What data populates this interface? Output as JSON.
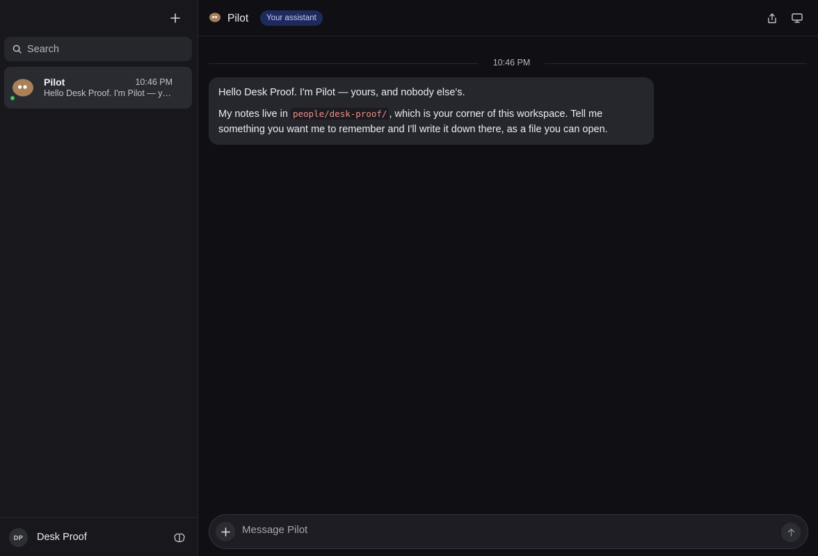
{
  "sidebar": {
    "new_chat_icon": "plus-icon",
    "search": {
      "placeholder": "Search",
      "value": ""
    },
    "conversations": [
      {
        "name": "Pilot",
        "time": "10:46 PM",
        "preview": "Hello Desk Proof. I'm Pilot — yours, and nobody else's.",
        "presence": "online"
      }
    ],
    "footer": {
      "initials": "DP",
      "name": "Desk Proof",
      "icon": "brain-icon"
    }
  },
  "header": {
    "title": "Pilot",
    "badge": "Your assistant",
    "actions": [
      "share-icon",
      "monitor-icon"
    ]
  },
  "chat": {
    "divider_time": "10:46 PM",
    "messages": [
      {
        "sender": "Pilot",
        "p1": "Hello Desk Proof. I'm Pilot — yours, and nobody else's.",
        "p2_before": "My notes live in ",
        "p2_code": "people/desk-proof/",
        "p2_after": ", which is your corner of this workspace. Tell me something you want me to remember and I'll write it down there, as a file you can open."
      }
    ]
  },
  "composer": {
    "placeholder": "Message Pilot",
    "value": ""
  },
  "colors": {
    "background": "#101014",
    "sidebar": "#17171c",
    "bubble": "#26262d",
    "badge_bg": "#1e2a5c",
    "badge_text": "#c3cdfa",
    "code_text": "#f0908a",
    "presence": "#3ec45a",
    "avatar": "#a9805a"
  }
}
